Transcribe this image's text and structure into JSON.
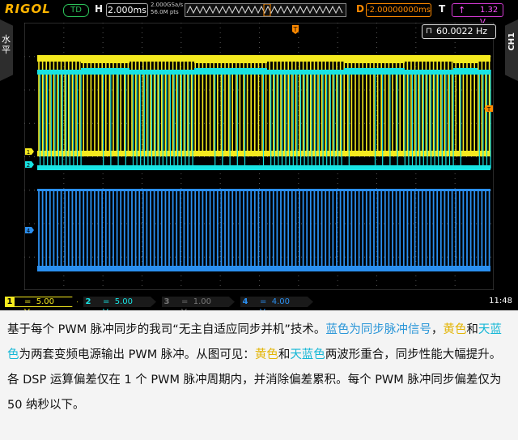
{
  "header": {
    "brand": "RIGOL",
    "run_state": "TD",
    "h_label": "H",
    "timebase": "2.000ms",
    "sample_rate": "2.000GSa/s",
    "memory_depth": "56.0M pts",
    "delay_label": "D",
    "delay": "-2.00000000ms",
    "trigger_label": "T",
    "trigger_level": "1.32 V",
    "trigger_icon": "rising-edge-icon"
  },
  "side": {
    "left_label": "水平",
    "right_label": "CH1"
  },
  "measure": {
    "frequency": "60.0022 Hz"
  },
  "markers": {
    "ch1": "1",
    "ch2": "2",
    "ch4": "4",
    "trigger": "T"
  },
  "channels": [
    {
      "num": "1",
      "coupling": "=",
      "scale": "5.00 V",
      "color": "#f5ea1f"
    },
    {
      "num": "2",
      "coupling": "=",
      "scale": "5.00 V",
      "color": "#18e4e4"
    },
    {
      "num": "3",
      "coupling": "=",
      "scale": "1.00 V",
      "color": "#777777"
    },
    {
      "num": "4",
      "coupling": "=",
      "scale": "4.00 V",
      "color": "#2a8ff0"
    }
  ],
  "clock": "11:48",
  "caption": {
    "p1": "基于每个 PWM 脉冲同步的我司“无主自适应同步并机”技术。",
    "blue1": "蓝色为同步脉冲信号",
    "c1": "，",
    "yellow1": "黄色",
    "p2": "和",
    "cyan1": "天蓝色",
    "p3": "为两套变频电源输出 PWM 脉冲。从图可见：",
    "yellow2": "黄色",
    "p4": "和",
    "cyan2": "天蓝色",
    "p5": "两波形重合，同步性能大幅提升。各 DSP 运算偏差仅在 1 个 PWM 脉冲周期内，并消除偏差累积。每个 PWM 脉冲同步偏差仅为 50 纳秒以下。"
  }
}
